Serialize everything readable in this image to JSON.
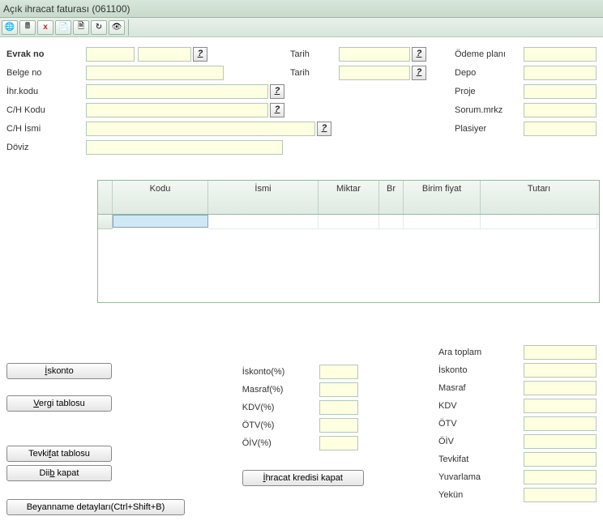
{
  "title": "Açık ihracat faturası (061100)",
  "toolbar_icons": [
    "globe",
    "calc",
    "xls",
    "doc",
    "page",
    "refresh",
    "eye"
  ],
  "form": {
    "evrak_no_label": "Evrak no",
    "belge_no_label": "Belge no",
    "ihr_kodu_label": "İhr.kodu",
    "ch_kodu_label": "C/H Kodu",
    "ch_ismi_label": "C/H İsmi",
    "doviz_label": "Döviz",
    "tarih_label_1": "Tarih",
    "tarih_label_2": "Tarih",
    "odeme_plani_label": "Ödeme planı",
    "depo_label": "Depo",
    "proje_label": "Proje",
    "sorum_mrkz_label": "Sorum.mrkz",
    "plasiyer_label": "Plasiyer",
    "help_glyph": "?"
  },
  "grid": {
    "headers": {
      "kodu": "Kodu",
      "ismi": "İsmi",
      "miktar": "Miktar",
      "br": "Br",
      "birim_fiyat": "Birim fiyat",
      "tutari": "Tutarı"
    }
  },
  "buttons": {
    "iskonto": "İskonto",
    "vergi_tablosu": "Vergi tablosu",
    "tevkifat_tablosu": "Tevkifat tablosu",
    "diib_kapat": "Diib kapat",
    "ihracat_kredisi_kapat": "İhracat kredisi kapat",
    "beyanname": "Beyanname detayları(Ctrl+Shift+B)"
  },
  "percentages": {
    "iskonto": "İskonto(%)",
    "masraf": "Masraf(%)",
    "kdv": "KDV(%)",
    "otv": "ÖTV(%)",
    "oiv": "ÖİV(%)"
  },
  "totals": {
    "ara_toplam": "Ara toplam",
    "iskonto": "İskonto",
    "masraf": "Masraf",
    "kdv": "KDV",
    "otv": "ÖTV",
    "oiv": "ÖİV",
    "tevkifat": "Tevkifat",
    "yuvarlama": "Yuvarlama",
    "yekun": "Yekün"
  }
}
